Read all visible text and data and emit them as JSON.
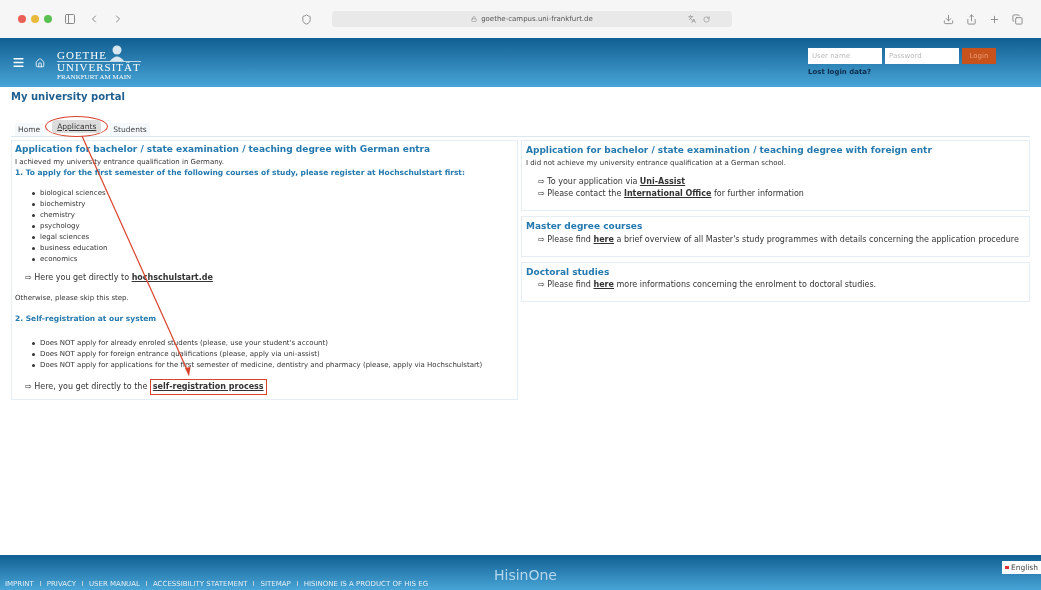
{
  "browser": {
    "url": "goethe-campus.uni-frankfurt.de"
  },
  "header": {
    "logo": {
      "line_1": "GOETHE",
      "line_2": "UNIVERSITÄT",
      "line_3": "FRANKFURT AM MAIN"
    },
    "login": {
      "username_placeholder": "User name",
      "password_placeholder": "Password",
      "button": "Login",
      "lost_link": "Lost login data?"
    }
  },
  "page_title": "My university portal",
  "tabs": [
    {
      "label": "Home",
      "selected": false
    },
    {
      "label": "Applicants",
      "selected": true
    },
    {
      "label": "Students",
      "selected": false
    }
  ],
  "left_panel": {
    "title": "Application for bachelor / state examination / teaching degree with German entra",
    "intro": "I achieved my university entrance qualification in Germany.",
    "step_1": "1. To apply for the first semester of the following courses of study, please register at Hochschulstart first:",
    "courses": [
      "biological sciences",
      "biochemistry",
      "chemistry",
      "psychology",
      "legal sciences",
      "business education",
      "economics"
    ],
    "hochschulstart": {
      "arrow": "⇨",
      "before": "Here you get directly to",
      "link": "hochschulstart.de"
    },
    "skip": "Otherwise, please skip this step.",
    "step_2": "2. Self-registration at our system",
    "notes": [
      "Does NOT apply for already enroled students (please, use your student's account)",
      "Does NOT apply for foreign entrance qualifications (please, apply via uni-assist)",
      "Does NOT apply for applications for the first semester of medicine, dentistry and pharmacy (please, apply via Hochschulstart)"
    ],
    "self_registration": {
      "arrow": "⇨",
      "before": "Here, you get directly to the",
      "link": "self-registration process"
    }
  },
  "right_panels": [
    {
      "title": "Application for bachelor / state examination / teaching degree with foreign entr",
      "intro": "I did not achieve my university entrance qualification at a German school.",
      "lines": [
        {
          "arrow": "⇨",
          "before": "To your application via",
          "link": "Uni-Assist"
        },
        {
          "arrow": "⇨",
          "before": "Please contact the",
          "link": "International Office",
          "after": "for further information"
        }
      ]
    },
    {
      "title": "Master degree courses",
      "lines": [
        {
          "arrow": "⇨",
          "before": "Please find",
          "link": "here",
          "after": "a brief overview of all Master's study programmes with details concerning the application procedure"
        }
      ]
    },
    {
      "title": "Doctoral studies",
      "lines": [
        {
          "arrow": "⇨",
          "before": "Please find",
          "link": "here",
          "after": "more informations concerning the enrolment to doctoral studies."
        }
      ]
    }
  ],
  "footer": {
    "links": [
      "IMPRINT",
      "PRIVACY",
      "USER MANUAL",
      "ACCESSIBILITY STATEMENT",
      "SITEMAP",
      "HISINONE IS A PRODUCT OF HIS EG"
    ],
    "brand": "HisinOne",
    "language": "English"
  }
}
